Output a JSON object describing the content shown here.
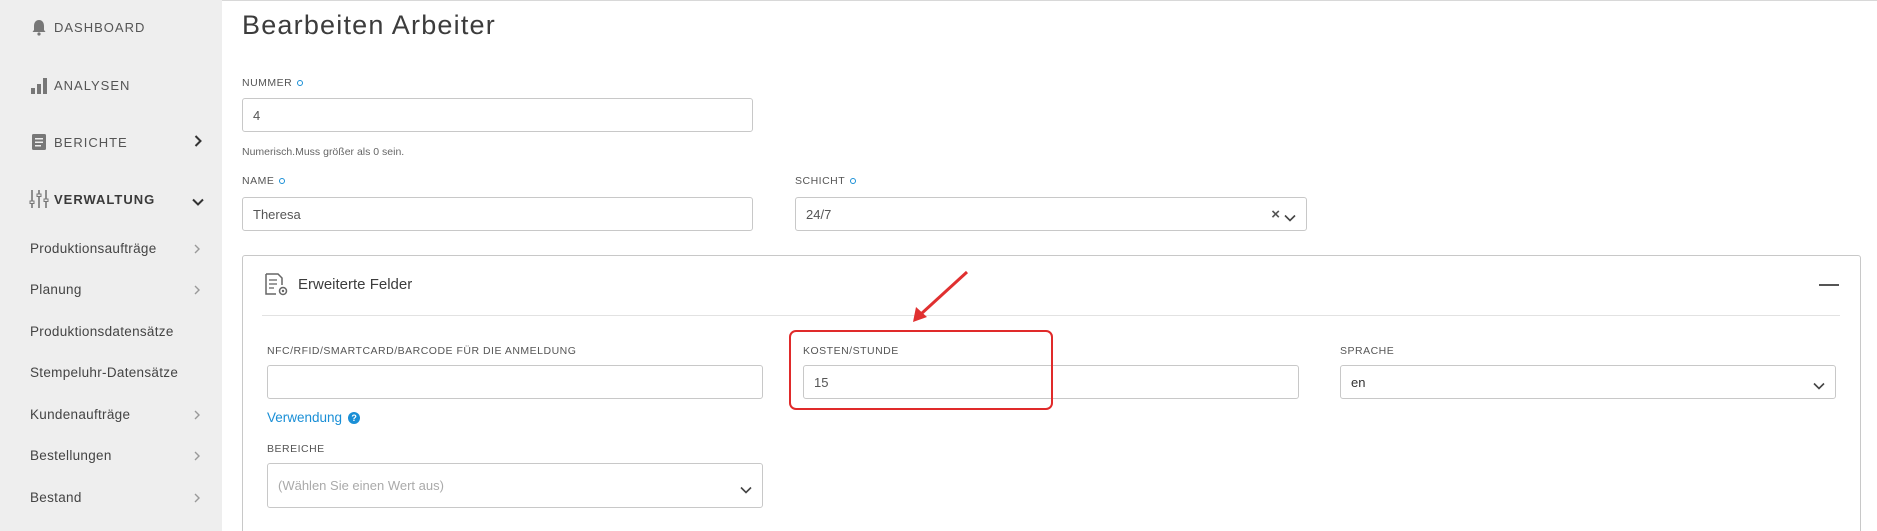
{
  "sidebar": {
    "top_items": [
      {
        "label": "DASHBOARD",
        "icon": "bell-icon"
      },
      {
        "label": "ANALYSEN",
        "icon": "bar-chart-icon"
      },
      {
        "label": "BERICHTE",
        "icon": "document-icon"
      },
      {
        "label": "VERWALTUNG",
        "icon": "sliders-icon"
      }
    ],
    "sub_items": [
      {
        "label": "Produktionsaufträge"
      },
      {
        "label": "Planung"
      },
      {
        "label": "Produktionsdatensätze"
      },
      {
        "label": "Stempeluhr-Datensätze"
      },
      {
        "label": "Kundenaufträge"
      },
      {
        "label": "Bestellungen"
      },
      {
        "label": "Bestand"
      }
    ]
  },
  "page": {
    "title": "Bearbeiten Arbeiter"
  },
  "form": {
    "nummer_label": "NUMMER",
    "nummer_value": "4",
    "nummer_help": "Numerisch.Muss größer als 0 sein.",
    "name_label": "NAME",
    "name_value": "Theresa",
    "schicht_label": "SCHICHT",
    "schicht_value": "24/7",
    "clear_symbol": "×"
  },
  "extended": {
    "title": "Erweiterte Felder",
    "nfc_label": "NFC/RFID/SMARTCARD/BARCODE FÜR DIE ANMELDUNG",
    "nfc_value": "",
    "kosten_label": "KOSTEN/STUNDE",
    "kosten_value": "15",
    "sprache_label": "SPRACHE",
    "sprache_value": "en",
    "verwendung_link": "Verwendung",
    "help_symbol": "?",
    "bereiche_label": "BEREICHE",
    "bereiche_placeholder": "(Wählen Sie einen Wert aus)"
  },
  "colors": {
    "accent": "#1a8fd6",
    "highlight": "#e02a2a",
    "sidebar_bg": "#eeeeee"
  }
}
